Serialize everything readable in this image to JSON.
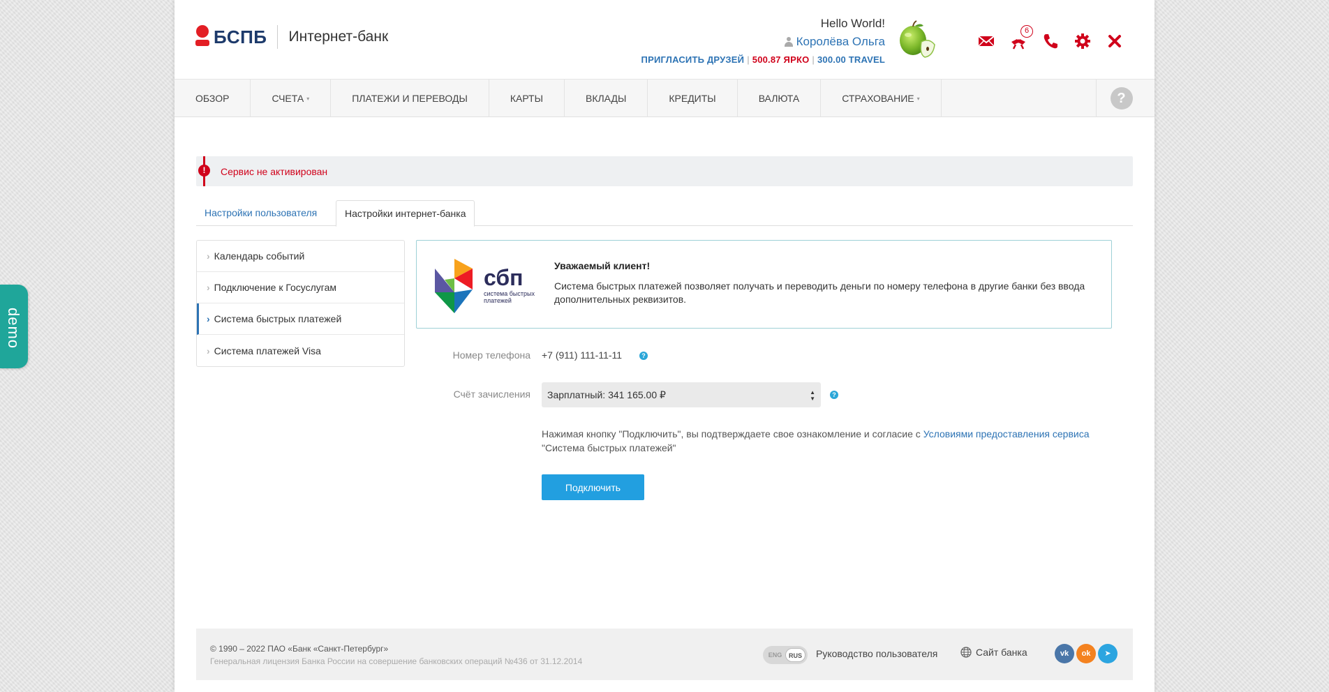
{
  "header": {
    "logo_text": "БСПБ",
    "logo_sub": "Интернет-банк",
    "greeting": "Hello World!",
    "user_name": "Королёва Ольга",
    "invite_label": "ПРИГЛАСИТЬ ДРУЗЕЙ",
    "bonus_yarko": "500.87 ЯРКО",
    "bonus_travel": "300.00 TRAVEL",
    "notifications_count": "6",
    "icons": [
      "mail-icon",
      "gift-icon",
      "phone-icon",
      "settings-icon",
      "close-icon"
    ],
    "accent_color": "#d0021b"
  },
  "nav": {
    "items": [
      {
        "label": "ОБЗОР",
        "dropdown": false
      },
      {
        "label": "СЧЕТА",
        "dropdown": true
      },
      {
        "label": "ПЛАТЕЖИ И ПЕРЕВОДЫ",
        "dropdown": false
      },
      {
        "label": "КАРТЫ",
        "dropdown": false
      },
      {
        "label": "ВКЛАДЫ",
        "dropdown": false
      },
      {
        "label": "КРЕДИТЫ",
        "dropdown": false
      },
      {
        "label": "ВАЛЮТА",
        "dropdown": false
      },
      {
        "label": "СТРАХОВАНИЕ",
        "dropdown": true
      }
    ],
    "help_label": "?"
  },
  "alert": {
    "text": "Сервис не активирован",
    "icon_glyph": "!"
  },
  "tabs": [
    {
      "label": "Настройки пользователя",
      "active": false
    },
    {
      "label": "Настройки интернет-банка",
      "active": true
    }
  ],
  "sidebar": {
    "items": [
      {
        "label": "Календарь событий",
        "active": false
      },
      {
        "label": "Подключение к Госуслугам",
        "active": false
      },
      {
        "label": "Система быстрых платежей",
        "active": true
      },
      {
        "label": "Система платежей Visa",
        "active": false
      }
    ]
  },
  "info": {
    "logo_text": "сбп",
    "logo_caption_1": "система быстрых",
    "logo_caption_2": "платежей",
    "title": "Уважаемый клиент!",
    "text": "Система быстрых платежей позволяет получать и переводить деньги по номеру телефона в другие банки без ввода дополнительных реквизитов."
  },
  "form": {
    "phone_label": "Номер телефона",
    "phone_value": "+7 (911) 111-11-11",
    "account_label": "Счёт зачисления",
    "account_value": "Зарплатный: 341 165.00 ₽",
    "note_prefix": "Нажимая кнопку \"Подключить\", вы подтверждаете свое ознакомление и согласие с ",
    "note_link": "Условиями предоставления сервиса",
    "note_suffix": " \"Система быстрых платежей\"",
    "submit_label": "Подключить",
    "help_glyph": "?"
  },
  "footer": {
    "copyright": "© 1990 – 2022 ПАО «Банк «Санкт-Петербург»",
    "license": "Генеральная лицензия Банка России на совершение банковских операций №436 от 31.12.2014",
    "lang_eng": "ENG",
    "lang_rus": "RUS",
    "guide_label": "Руководство пользователя",
    "site_label": "Сайт банка",
    "social": [
      {
        "name": "vk",
        "glyph": "vk",
        "color": "#4a76a8"
      },
      {
        "name": "ok",
        "glyph": "ok",
        "color": "#f4821f"
      },
      {
        "name": "telegram",
        "glyph": "➤",
        "color": "#2ca5e0"
      }
    ]
  },
  "demo_label": "demo"
}
